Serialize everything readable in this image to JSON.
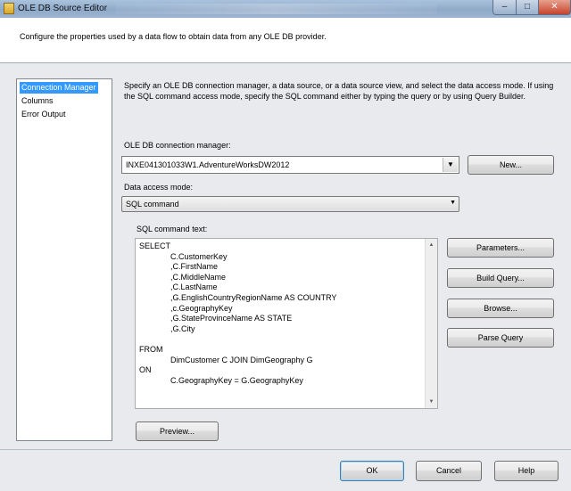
{
  "window": {
    "title": "OLE DB Source Editor",
    "controls": {
      "minimize": "–",
      "maximize": "□",
      "close": "✕"
    }
  },
  "header": {
    "description": "Configure the properties used by a data flow to obtain data from any OLE DB provider."
  },
  "nav": {
    "items": [
      {
        "label": "Connection Manager",
        "selected": true
      },
      {
        "label": "Columns",
        "selected": false
      },
      {
        "label": "Error Output",
        "selected": false
      }
    ]
  },
  "main": {
    "intro": "Specify an OLE DB connection manager, a data source, or a data source view, and select the data access mode. If using the SQL command access mode, specify the SQL command either by typing the query or by using Query Builder.",
    "connection_label": "OLE DB connection manager:",
    "connection_value": "INXE041301033W1.AdventureWorksDW2012",
    "new_button": "New...",
    "access_mode_label": "Data access mode:",
    "access_mode_value": "SQL command",
    "sql_label": "SQL command text:",
    "sql_text": "SELECT\n              C.CustomerKey\n              ,C.FirstName\n              ,C.MiddleName\n              ,C.LastName\n              ,G.EnglishCountryRegionName AS COUNTRY\n              ,c.GeographyKey\n              ,G.StateProvinceName AS STATE\n              ,G.City\n\nFROM\n              DimCustomer C JOIN DimGeography G\nON\n              C.GeographyKey = G.GeographyKey",
    "buttons": {
      "parameters": "Parameters...",
      "build_query": "Build Query...",
      "browse": "Browse...",
      "parse_query": "Parse Query",
      "preview": "Preview..."
    }
  },
  "footer": {
    "ok": "OK",
    "cancel": "Cancel",
    "help": "Help"
  },
  "icons": {
    "dropdown": "▼",
    "scroll_up": "▲",
    "scroll_down": "▼"
  }
}
